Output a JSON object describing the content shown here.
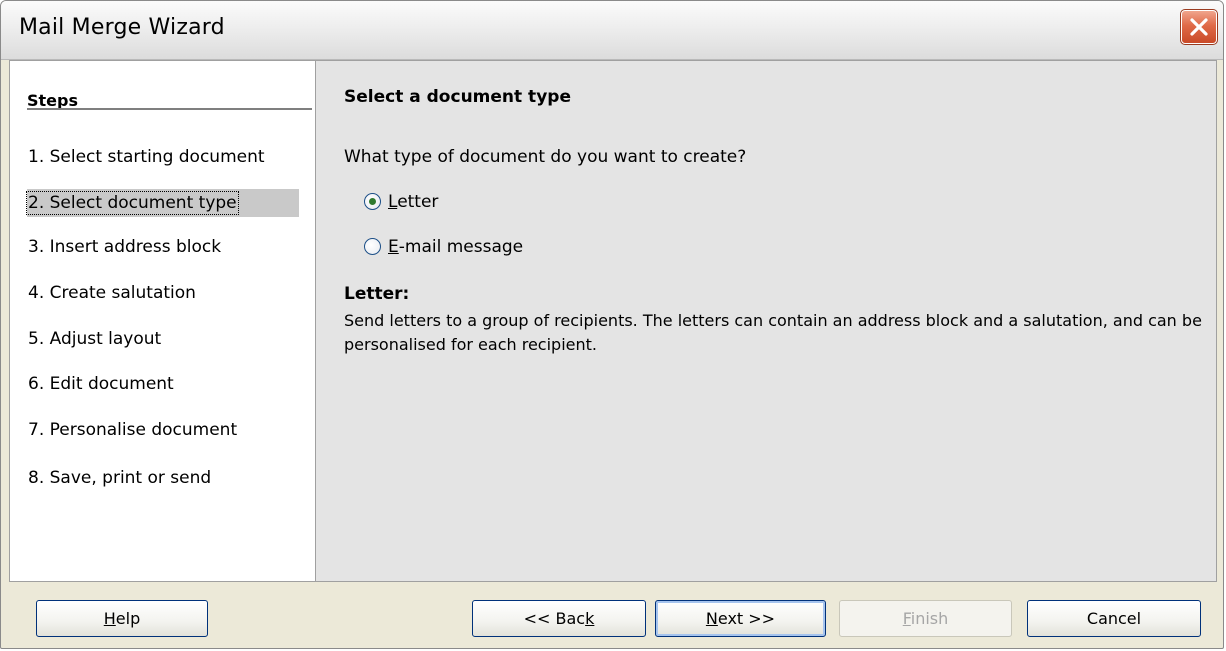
{
  "window": {
    "title": "Mail Merge Wizard"
  },
  "steps": {
    "header": "Steps",
    "items": [
      {
        "label": "1. Select starting document"
      },
      {
        "label": "2. Select document type",
        "selected": true
      },
      {
        "label": "3. Insert address block"
      },
      {
        "label": "4. Create salutation"
      },
      {
        "label": "5. Adjust layout"
      },
      {
        "label": "6. Edit document"
      },
      {
        "label": "7. Personalise document"
      },
      {
        "label": "8. Save, print or send"
      }
    ]
  },
  "main": {
    "heading": "Select a document type",
    "question": "What type of document do you want to create?",
    "options": [
      {
        "accel": "L",
        "rest": "etter",
        "checked": true
      },
      {
        "accel": "E",
        "rest": "-mail message",
        "checked": false
      }
    ],
    "description_title": "Letter:",
    "description": "Send letters to a group of recipients. The letters can contain an address block and a salutation, and can be personalised for each recipient."
  },
  "buttons": {
    "help": {
      "accel": "H",
      "rest": "elp"
    },
    "back": {
      "prefix": "<< Bac",
      "accel": "k"
    },
    "next": {
      "accel": "N",
      "rest": "ext >>"
    },
    "finish": {
      "accel": "F",
      "rest": "inish",
      "enabled": false
    },
    "cancel": {
      "label": "Cancel"
    }
  },
  "colors": {
    "panel_background": "#e4e4e4",
    "selected_step": "#c9c9c9",
    "close_button": "#e06a48",
    "button_border": "#00317a"
  },
  "icons": {
    "close": "close-x-icon",
    "radio": "radio-button"
  }
}
